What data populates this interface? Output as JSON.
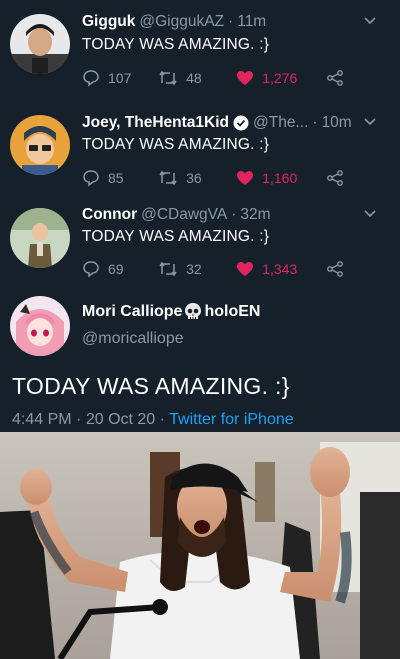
{
  "tweets": [
    {
      "name": "Gigguk",
      "handle": "@GiggukAZ",
      "time": "11m",
      "text": "TODAY WAS AMAZING. :}",
      "replies": "107",
      "retweets": "48",
      "likes": "1,276",
      "verified": false
    },
    {
      "name": "Joey, TheHenta1Kid",
      "handle": "@The...",
      "time": "10m",
      "text": "TODAY WAS AMAZING. :}",
      "replies": "85",
      "retweets": "36",
      "likes": "1,160",
      "verified": true
    },
    {
      "name": "Connor",
      "handle": "@CDawgVA",
      "time": "32m",
      "text": "TODAY WAS AMAZING. :}",
      "replies": "69",
      "retweets": "32",
      "likes": "1,343",
      "verified": false
    }
  ],
  "main_tweet": {
    "name_part1": "Mori Calliope",
    "name_part2": "holoEN",
    "handle": "@moricalliope",
    "text": "TODAY WAS AMAZING. :}",
    "time": "4:44 PM",
    "date": "20 Oct 20",
    "source": "Twitter for iPhone"
  },
  "colors": {
    "background": "#15202b",
    "text_secondary": "#8899a6",
    "like": "#e0245e",
    "link": "#1da1f2"
  },
  "icons": [
    "reply-icon",
    "retweet-icon",
    "heart-icon",
    "share-icon",
    "chevron-down-icon",
    "verified-icon",
    "skull-icon"
  ]
}
